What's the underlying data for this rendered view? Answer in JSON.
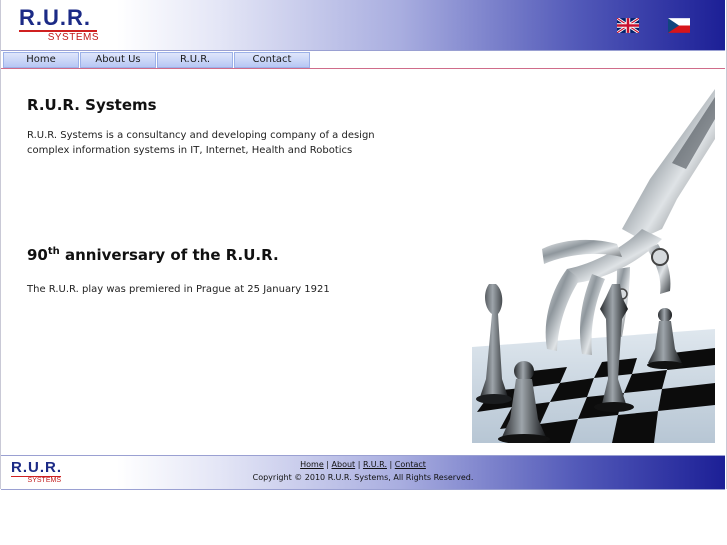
{
  "header": {
    "logo_main": "R.U.R.",
    "logo_sub": "SYSTEMS",
    "flags": [
      "uk-flag-icon",
      "cz-flag-icon"
    ]
  },
  "nav": {
    "items": [
      {
        "label": "Home"
      },
      {
        "label": "About Us"
      },
      {
        "label": "R.U.R."
      },
      {
        "label": "Contact"
      }
    ]
  },
  "main": {
    "title": "R.U.R. Systems",
    "intro": "R.U.R. Systems is a consultancy and developing company of a design complex information systems in IT, Internet, Health and Robotics",
    "anniversary_number": "90",
    "anniversary_suffix": "th",
    "anniversary_rest": " anniversary of the R.U.R.",
    "premiere": "The R.U.R. play was premiered in Prague at 25 January 1921",
    "image_icon": "robot-hand-chess-image"
  },
  "footer": {
    "logo_main": "R.U.R.",
    "logo_sub": "SYSTEMS",
    "links": [
      "Home",
      "About",
      "R.U.R.",
      "Contact"
    ],
    "separator": " | ",
    "copyright": "Copyright © 2010 R.U.R. Systems, All Rights Reserved."
  },
  "colors": {
    "brand_blue": "#1b2a86",
    "brand_red": "#c01818",
    "gradient_end": "#1c1f96",
    "nav_tab": "#b7c7f4"
  }
}
